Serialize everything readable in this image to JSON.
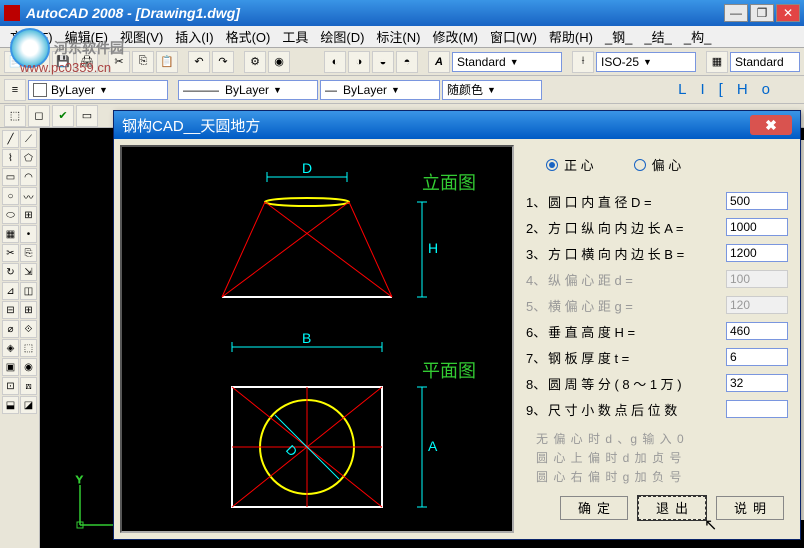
{
  "app": {
    "title": "AutoCAD 2008 - [Drawing1.dwg]",
    "watermark_text": "河东软件园",
    "watermark_url": "www.pc0359.cn"
  },
  "menu": [
    "文件(F)",
    "编辑(E)",
    "视图(V)",
    "插入(I)",
    "格式(O)",
    "工具",
    "绘图(D)",
    "标注(N)",
    "修改(M)",
    "窗口(W)",
    "帮助(H)",
    "_钢_",
    "_结_",
    "_构_"
  ],
  "toolbar2": {
    "text_style": "Standard",
    "dim_style": "ISO-25",
    "std2": "Standard"
  },
  "toolbar3": {
    "layer": "ByLayer",
    "linetype": "ByLayer",
    "lineweight": "ByLayer",
    "color": "随颜色",
    "right_labels": [
      "L",
      "I",
      "[",
      "H",
      "o"
    ]
  },
  "dialog": {
    "title": "钢构CAD__天圆地方",
    "radio": {
      "opt1": "正 心",
      "opt2": "偏 心"
    },
    "preview_labels": {
      "elev": "立面图",
      "plan": "平面图"
    },
    "fields": [
      {
        "num": "1、",
        "label": "圆 口 内 直 径 D =",
        "value": "500",
        "disabled": false
      },
      {
        "num": "2、",
        "label": "方 口 纵 向 内 边 长 A =",
        "value": "1000",
        "disabled": false
      },
      {
        "num": "3、",
        "label": "方 口 横 向 内 边 长 B =",
        "value": "1200",
        "disabled": false
      },
      {
        "num": "4、",
        "label": "纵  偏  心  距  d =",
        "value": "100",
        "disabled": true
      },
      {
        "num": "5、",
        "label": "横  偏  心  距  g =",
        "value": "120",
        "disabled": true
      },
      {
        "num": "6、",
        "label": "垂 直 高 度 H =",
        "value": "460",
        "disabled": false
      },
      {
        "num": "7、",
        "label": "钢 板 厚 度 t =",
        "value": "6",
        "disabled": false
      },
      {
        "num": "8、",
        "label": "圆 周 等 分  ( 8 ～ 1 万 )",
        "value": "32",
        "disabled": false
      },
      {
        "num": "9、",
        "label": "尺 寸 小 数 点 后 位 数",
        "value": "",
        "disabled": false
      }
    ],
    "hint": "无 偏 心 时  d 、g  输 入  0\n圆 心 上 偏 时   d  加 贞 号\n圆 心 右 偏 时   g  加 负 号",
    "buttons": {
      "ok": "确定",
      "exit": "退出",
      "help": "说明"
    }
  }
}
